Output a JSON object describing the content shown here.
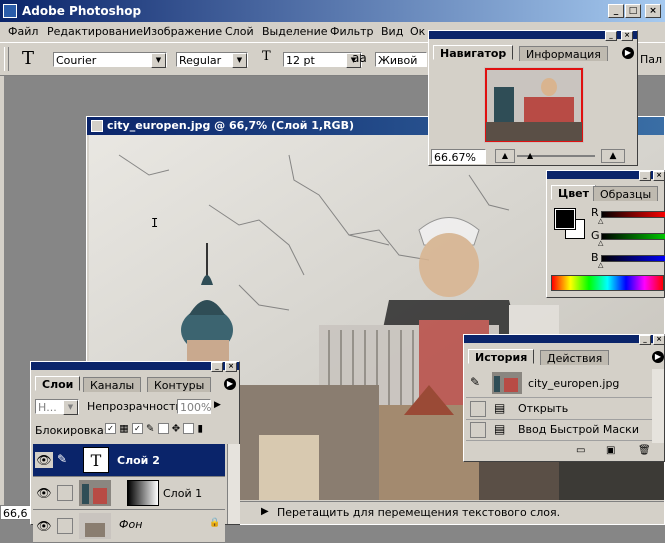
{
  "app": {
    "title": "Adobe Photoshop"
  },
  "menu": [
    "Файл",
    "Редактирование",
    "Изображение",
    "Слой",
    "Выделение",
    "Фильтр",
    "Вид",
    "Ок"
  ],
  "options": {
    "tool_glyph": "T",
    "font_family": "Courier",
    "font_style": "Regular",
    "size_glyph": "T",
    "font_size": "12 pt",
    "aa_glyph": "aa",
    "antialias": "Живой",
    "palette_label": "Пал"
  },
  "document": {
    "title": "city_europen.jpg @ 66,7% (Слой 1,RGB)",
    "zoom": "66,6",
    "status": "Перетащить для перемещения текстового слоя."
  },
  "navigator": {
    "tabs": [
      "Навигатор",
      "Информация"
    ],
    "zoom": "66.67%"
  },
  "color": {
    "tabs": [
      "Цвет",
      "Образцы"
    ],
    "channels": [
      "R",
      "G",
      "B"
    ]
  },
  "layers": {
    "tabs": [
      "Слои",
      "Каналы",
      "Контуры"
    ],
    "mode": "Н...",
    "opacity_label": "Непрозрачность:",
    "opacity": "100%",
    "lock_label": "Блокировка:",
    "rows": [
      {
        "thumb": "T",
        "name": "Слой 2",
        "selected": true
      },
      {
        "thumb": "",
        "name": "Слой 1",
        "selected": false
      },
      {
        "thumb": "",
        "name": "Фон",
        "selected": false
      }
    ]
  },
  "history": {
    "tabs": [
      "История",
      "Действия"
    ],
    "snapshot": "city_europen.jpg",
    "items": [
      "Открыть",
      "Ввод Быстрой Маски"
    ]
  },
  "colors": {
    "title_blue": "#0a246a",
    "panel_gray": "#d4d0c8",
    "workspace": "#868686"
  }
}
